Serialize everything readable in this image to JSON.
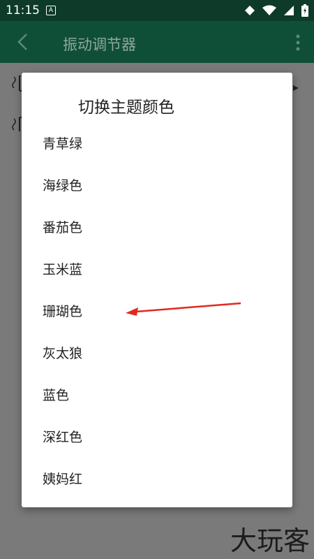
{
  "status_bar": {
    "time": "11:15",
    "badge": "A"
  },
  "app_bar": {
    "title": "振动调节器"
  },
  "dialog": {
    "title": "切换主题颜色",
    "options": [
      {
        "label": "青草绿"
      },
      {
        "label": "海绿色"
      },
      {
        "label": "番茄色"
      },
      {
        "label": "玉米蓝"
      },
      {
        "label": "珊瑚色"
      },
      {
        "label": "灰太狼"
      },
      {
        "label": "蓝色"
      },
      {
        "label": "深红色"
      },
      {
        "label": "姨妈红"
      }
    ]
  },
  "watermark": "大玩客",
  "colors": {
    "status_bar": "#0d3a29",
    "app_bar": "#0f4f37",
    "dialog_bg": "#ffffff",
    "arrow": "#e02a20"
  }
}
